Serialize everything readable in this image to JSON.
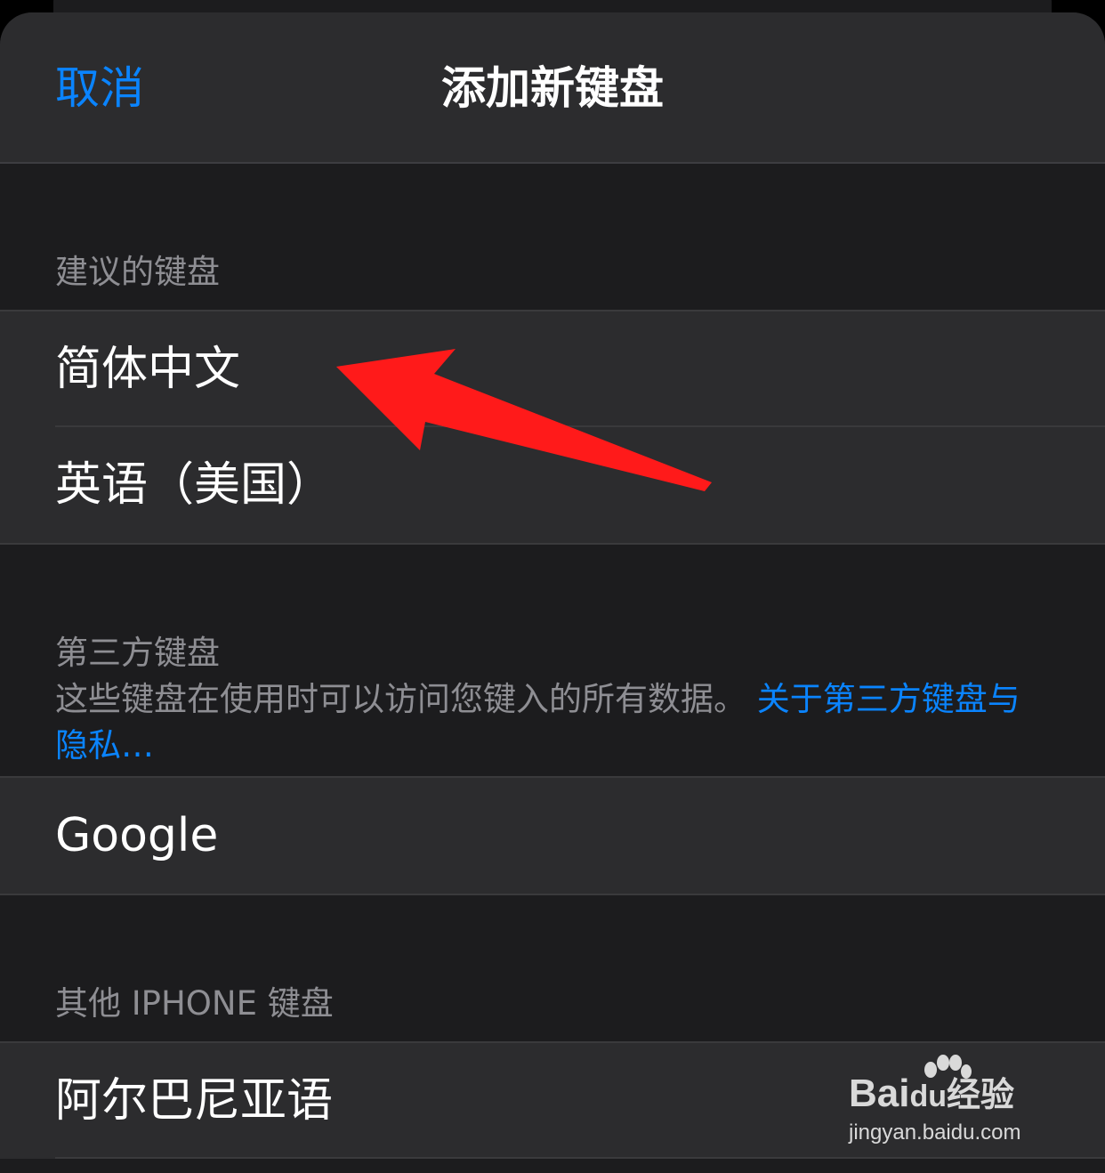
{
  "nav": {
    "cancel_label": "取消",
    "title": "添加新键盘"
  },
  "suggested": {
    "header": "建议的键盘",
    "items": [
      {
        "label": "简体中文"
      },
      {
        "label": "英语（美国）"
      }
    ]
  },
  "third_party": {
    "header": "第三方键盘",
    "description": "这些键盘在使用时可以访问您键入的所有数据。",
    "link": "关于第三方键盘与隐私…",
    "items": [
      {
        "label": "Google"
      }
    ]
  },
  "other": {
    "header": "其他 IPHONE 键盘",
    "items": [
      {
        "label": "阿尔巴尼亚语"
      }
    ]
  },
  "watermark": {
    "brand_pre": "Bai",
    "brand_mid": "du",
    "brand_post": "经验",
    "url": "jingyan.baidu.com"
  },
  "colors": {
    "accent": "#0a84ff",
    "annotation_arrow": "#ff1a1a",
    "background": "#1c1c1e",
    "cell": "#2c2c2e"
  }
}
